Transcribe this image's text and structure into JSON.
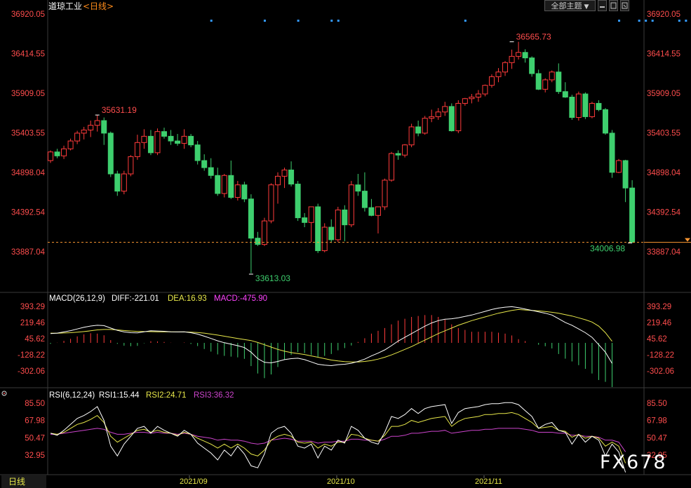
{
  "header": {
    "title": "道琼工业",
    "period": "<日线>",
    "theme_button": "全部主题",
    "theme_arrow": "▼"
  },
  "colors": {
    "up": "#ff3b3b",
    "down": "#3ecf6e",
    "axis_text": "#ff4d4d",
    "price_line": "#ff9933",
    "diff": "#ffffff",
    "dea": "#e8e84a",
    "macd": "#ff44ff",
    "rsi1": "#ffffff",
    "rsi2": "#e8e84a",
    "rsi3": "#cc44cc",
    "marker": "#3399ff"
  },
  "bottom_bar": {
    "period_tab": "日线",
    "x_labels": [
      "2021/09",
      "2021/10",
      "2021/11"
    ]
  },
  "watermark": "FX678",
  "chart_data": [
    {
      "type": "candlestick",
      "title": "道琼工业",
      "y_ticks": [
        "36920.05",
        "36414.55",
        "35909.05",
        "35403.55",
        "34898.04",
        "34392.54",
        "33887.04"
      ],
      "ylim": [
        33630,
        36920.05
      ],
      "annotations": {
        "high": "36565.73",
        "local_high": "35631.19",
        "low": "33613.03",
        "last": "34006.98"
      },
      "last_price": 34006.98,
      "x_axis": [
        "2021/09",
        "2021/10",
        "2021/11"
      ],
      "marker_columns": [
        24,
        32,
        37,
        42,
        43,
        62,
        85,
        88,
        89,
        90,
        94,
        95,
        98
      ],
      "ohlc": [
        [
          35050,
          35180,
          35020,
          35160
        ],
        [
          35160,
          35200,
          35080,
          35110
        ],
        [
          35110,
          35240,
          35070,
          35200
        ],
        [
          35200,
          35330,
          35180,
          35300
        ],
        [
          35300,
          35430,
          35260,
          35400
        ],
        [
          35400,
          35480,
          35320,
          35440
        ],
        [
          35440,
          35560,
          35350,
          35500
        ],
        [
          35500,
          35631,
          35420,
          35560
        ],
        [
          35560,
          35600,
          35250,
          35400
        ],
        [
          35400,
          35420,
          34840,
          34880
        ],
        [
          34880,
          34920,
          34600,
          34660
        ],
        [
          34660,
          34920,
          34620,
          34880
        ],
        [
          34880,
          35120,
          34850,
          35100
        ],
        [
          35100,
          35380,
          35060,
          35280
        ],
        [
          35280,
          35450,
          35200,
          35360
        ],
        [
          35360,
          35440,
          35120,
          35150
        ],
        [
          35150,
          35460,
          35120,
          35420
        ],
        [
          35420,
          35470,
          35330,
          35360
        ],
        [
          35360,
          35440,
          35250,
          35300
        ],
        [
          35300,
          35390,
          35240,
          35270
        ],
        [
          35270,
          35450,
          35200,
          35360
        ],
        [
          35360,
          35390,
          35220,
          35250
        ],
        [
          35250,
          35300,
          35000,
          35050
        ],
        [
          35050,
          35130,
          34920,
          34960
        ],
        [
          34960,
          35080,
          34820,
          34860
        ],
        [
          34860,
          34960,
          34600,
          34630
        ],
        [
          34630,
          34880,
          34580,
          34860
        ],
        [
          34860,
          35050,
          34560,
          34580
        ],
        [
          34580,
          34790,
          34540,
          34740
        ],
        [
          34740,
          34780,
          34520,
          34560
        ],
        [
          34560,
          34620,
          33613,
          34060
        ],
        [
          34060,
          34140,
          33960,
          33980
        ],
        [
          33980,
          34320,
          33960,
          34280
        ],
        [
          34280,
          34760,
          34250,
          34740
        ],
        [
          34740,
          34900,
          34500,
          34850
        ],
        [
          34850,
          34960,
          34700,
          34930
        ],
        [
          34930,
          35040,
          34720,
          34750
        ],
        [
          34750,
          34790,
          34280,
          34320
        ],
        [
          34320,
          34380,
          34200,
          34260
        ],
        [
          34260,
          34450,
          34010,
          34460
        ],
        [
          34460,
          34500,
          33870,
          33900
        ],
        [
          33900,
          34250,
          33880,
          34200
        ],
        [
          34200,
          34300,
          34000,
          34040
        ],
        [
          34040,
          34460,
          34010,
          34420
        ],
        [
          34420,
          34480,
          34020,
          34230
        ],
        [
          34230,
          34790,
          34200,
          34740
        ],
        [
          34740,
          34880,
          34600,
          34660
        ],
        [
          34660,
          34900,
          34400,
          34450
        ],
        [
          34450,
          34560,
          34340,
          34350
        ],
        [
          34350,
          34420,
          34120,
          34460
        ],
        [
          34460,
          34820,
          34420,
          34800
        ],
        [
          34800,
          35160,
          34780,
          35140
        ],
        [
          35140,
          35180,
          35060,
          35120
        ],
        [
          35120,
          35260,
          35090,
          35250
        ],
        [
          35250,
          35520,
          35220,
          35480
        ],
        [
          35480,
          35560,
          35360,
          35400
        ],
        [
          35400,
          35620,
          35380,
          35590
        ],
        [
          35590,
          35700,
          35540,
          35610
        ],
        [
          35610,
          35720,
          35570,
          35670
        ],
        [
          35670,
          35800,
          35620,
          35740
        ],
        [
          35740,
          35780,
          35420,
          35430
        ],
        [
          35430,
          35820,
          35400,
          35780
        ],
        [
          35780,
          35850,
          35750,
          35840
        ],
        [
          35840,
          35900,
          35780,
          35860
        ],
        [
          35860,
          35950,
          35800,
          35900
        ],
        [
          35900,
          36020,
          35870,
          36010
        ],
        [
          36010,
          36150,
          35980,
          36120
        ],
        [
          36120,
          36230,
          36050,
          36180
        ],
        [
          36180,
          36320,
          36130,
          36300
        ],
        [
          36300,
          36466,
          36220,
          36380
        ],
        [
          36380,
          36565.73,
          36340,
          36430
        ],
        [
          36430,
          36470,
          36300,
          36360
        ],
        [
          36360,
          36380,
          36120,
          36160
        ],
        [
          36160,
          36210,
          35950,
          35960
        ],
        [
          35960,
          36100,
          35920,
          36080
        ],
        [
          36080,
          36200,
          36050,
          36180
        ],
        [
          36180,
          36290,
          35900,
          35930
        ],
        [
          35930,
          36050,
          35850,
          35860
        ],
        [
          35860,
          35890,
          35570,
          35600
        ],
        [
          35600,
          35930,
          35560,
          35900
        ],
        [
          35900,
          35920,
          35580,
          35610
        ],
        [
          35610,
          35800,
          35590,
          35780
        ],
        [
          35780,
          35820,
          35680,
          35700
        ],
        [
          35700,
          35720,
          35380,
          35400
        ],
        [
          35400,
          35440,
          34830,
          34900
        ],
        [
          34900,
          35070,
          34890,
          35050
        ],
        [
          35050,
          35060,
          34520,
          34700
        ],
        [
          34700,
          34800,
          34006.98,
          34006.98
        ]
      ]
    },
    {
      "type": "bar+line",
      "title": "MACD(26,12,9)",
      "legend": {
        "name": "MACD(26,12,9)",
        "diff": "DIFF:-221.01",
        "dea": "DEA:16.93",
        "macd": "MACD:-475.90"
      },
      "y_ticks": [
        "393.29",
        "219.46",
        "45.62",
        "-128.22",
        "-302.06"
      ],
      "ylim": [
        -476,
        460
      ],
      "last": {
        "DIFF": -221.01,
        "DEA": 16.93,
        "MACD": -475.9
      },
      "series": [
        {
          "name": "DIFF",
          "values": [
            100,
            105,
            118,
            132,
            150,
            168,
            182,
            190,
            186,
            160,
            135,
            118,
            110,
            108,
            120,
            130,
            128,
            125,
            120,
            118,
            120,
            110,
            95,
            72,
            48,
            22,
            2,
            -14,
            -30,
            -50,
            -100,
            -170,
            -210,
            -215,
            -200,
            -180,
            -170,
            -165,
            -180,
            -205,
            -230,
            -240,
            -245,
            -235,
            -230,
            -220,
            -200,
            -175,
            -140,
            -110,
            -75,
            -30,
            20,
            60,
            100,
            140,
            180,
            215,
            240,
            255,
            260,
            270,
            285,
            300,
            320,
            340,
            360,
            375,
            385,
            390,
            380,
            365,
            350,
            335,
            320,
            300,
            260,
            220,
            190,
            150,
            110,
            60,
            -20,
            -100,
            -221.01
          ]
        },
        {
          "name": "DEA",
          "values": [
            105,
            104,
            107,
            110,
            115,
            122,
            130,
            140,
            145,
            145,
            140,
            133,
            128,
            124,
            122,
            121,
            120,
            120,
            119,
            118,
            118,
            116,
            112,
            105,
            95,
            84,
            72,
            60,
            48,
            36,
            25,
            5,
            -20,
            -45,
            -70,
            -90,
            -105,
            -115,
            -125,
            -140,
            -155,
            -170,
            -185,
            -195,
            -202,
            -206,
            -205,
            -200,
            -190,
            -175,
            -155,
            -130,
            -100,
            -70,
            -40,
            -5,
            30,
            65,
            100,
            130,
            160,
            190,
            215,
            240,
            260,
            280,
            300,
            320,
            335,
            350,
            360,
            355,
            350,
            345,
            338,
            330,
            320,
            305,
            290,
            270,
            250,
            225,
            180,
            110,
            16.93
          ]
        },
        {
          "name": "MACD",
          "values": [
            -10,
            2,
            22,
            44,
            70,
            92,
            104,
            100,
            82,
            30,
            -10,
            -30,
            -36,
            -32,
            -4,
            18,
            16,
            10,
            2,
            0,
            4,
            -12,
            -34,
            -66,
            -94,
            -124,
            -140,
            -148,
            -156,
            -172,
            -250,
            -330,
            -380,
            -340,
            -260,
            -180,
            -130,
            -100,
            -110,
            -130,
            -150,
            -140,
            -120,
            -80,
            -56,
            -28,
            10,
            50,
            100,
            130,
            160,
            200,
            240,
            260,
            280,
            290,
            300,
            300,
            280,
            250,
            200,
            160,
            140,
            120,
            120,
            120,
            120,
            110,
            100,
            80,
            40,
            20,
            0,
            -20,
            -36,
            -60,
            -120,
            -170,
            -200,
            -240,
            -280,
            -330,
            -400,
            -420,
            -475.9
          ]
        }
      ]
    },
    {
      "type": "line",
      "title": "RSI(6,12,24)",
      "legend": {
        "name": "RSI(6,12,24)",
        "rsi1": "RSI1:15.44",
        "rsi2": "RSI2:24.71",
        "rsi3": "RSI3:36.32"
      },
      "y_ticks": [
        "85.50",
        "67.98",
        "50.47",
        "32.95"
      ],
      "ylim": [
        10,
        90
      ],
      "last": {
        "RSI1": 15.44,
        "RSI2": 24.71,
        "RSI3": 36.32
      },
      "series": [
        {
          "name": "RSI1",
          "values": [
            55,
            53,
            58,
            64,
            70,
            73,
            77,
            82,
            68,
            42,
            32,
            44,
            52,
            60,
            62,
            55,
            62,
            58,
            55,
            52,
            58,
            54,
            45,
            40,
            35,
            28,
            38,
            32,
            42,
            34,
            22,
            20,
            34,
            55,
            60,
            62,
            55,
            42,
            40,
            44,
            30,
            42,
            38,
            48,
            45,
            62,
            58,
            50,
            46,
            44,
            56,
            72,
            70,
            74,
            80,
            75,
            80,
            82,
            83,
            84,
            65,
            76,
            80,
            81,
            82,
            84,
            85,
            85,
            86,
            86,
            84,
            78,
            72,
            60,
            64,
            66,
            58,
            56,
            44,
            54,
            46,
            52,
            48,
            32,
            44,
            36,
            15.44
          ]
        },
        {
          "name": "RSI2",
          "values": [
            55,
            54,
            56,
            60,
            64,
            66,
            69,
            73,
            66,
            52,
            46,
            50,
            54,
            58,
            59,
            56,
            58,
            56,
            55,
            53,
            56,
            54,
            50,
            47,
            44,
            40,
            44,
            40,
            44,
            40,
            34,
            32,
            38,
            48,
            52,
            54,
            52,
            46,
            45,
            46,
            40,
            44,
            42,
            46,
            46,
            54,
            53,
            50,
            48,
            47,
            53,
            62,
            62,
            64,
            68,
            66,
            68,
            70,
            71,
            72,
            62,
            67,
            70,
            71,
            72,
            74,
            74,
            75,
            75,
            76,
            74,
            70,
            66,
            60,
            61,
            62,
            58,
            57,
            51,
            54,
            50,
            52,
            50,
            42,
            46,
            42,
            24.71
          ]
        },
        {
          "name": "RSI3",
          "values": [
            54,
            54,
            55,
            56,
            57,
            58,
            59,
            60,
            59,
            56,
            54,
            54,
            55,
            56,
            56,
            55,
            56,
            55,
            55,
            54,
            55,
            54,
            52,
            51,
            50,
            48,
            49,
            48,
            48,
            47,
            45,
            44,
            45,
            48,
            49,
            50,
            49,
            47,
            47,
            47,
            45,
            46,
            46,
            47,
            47,
            49,
            49,
            48,
            48,
            47,
            49,
            52,
            52,
            53,
            55,
            55,
            56,
            57,
            57,
            58,
            55,
            56,
            57,
            58,
            58,
            59,
            59,
            60,
            60,
            60,
            60,
            59,
            58,
            56,
            56,
            56,
            55,
            55,
            53,
            53,
            52,
            52,
            51,
            48,
            48,
            46,
            36.32
          ]
        }
      ]
    }
  ]
}
